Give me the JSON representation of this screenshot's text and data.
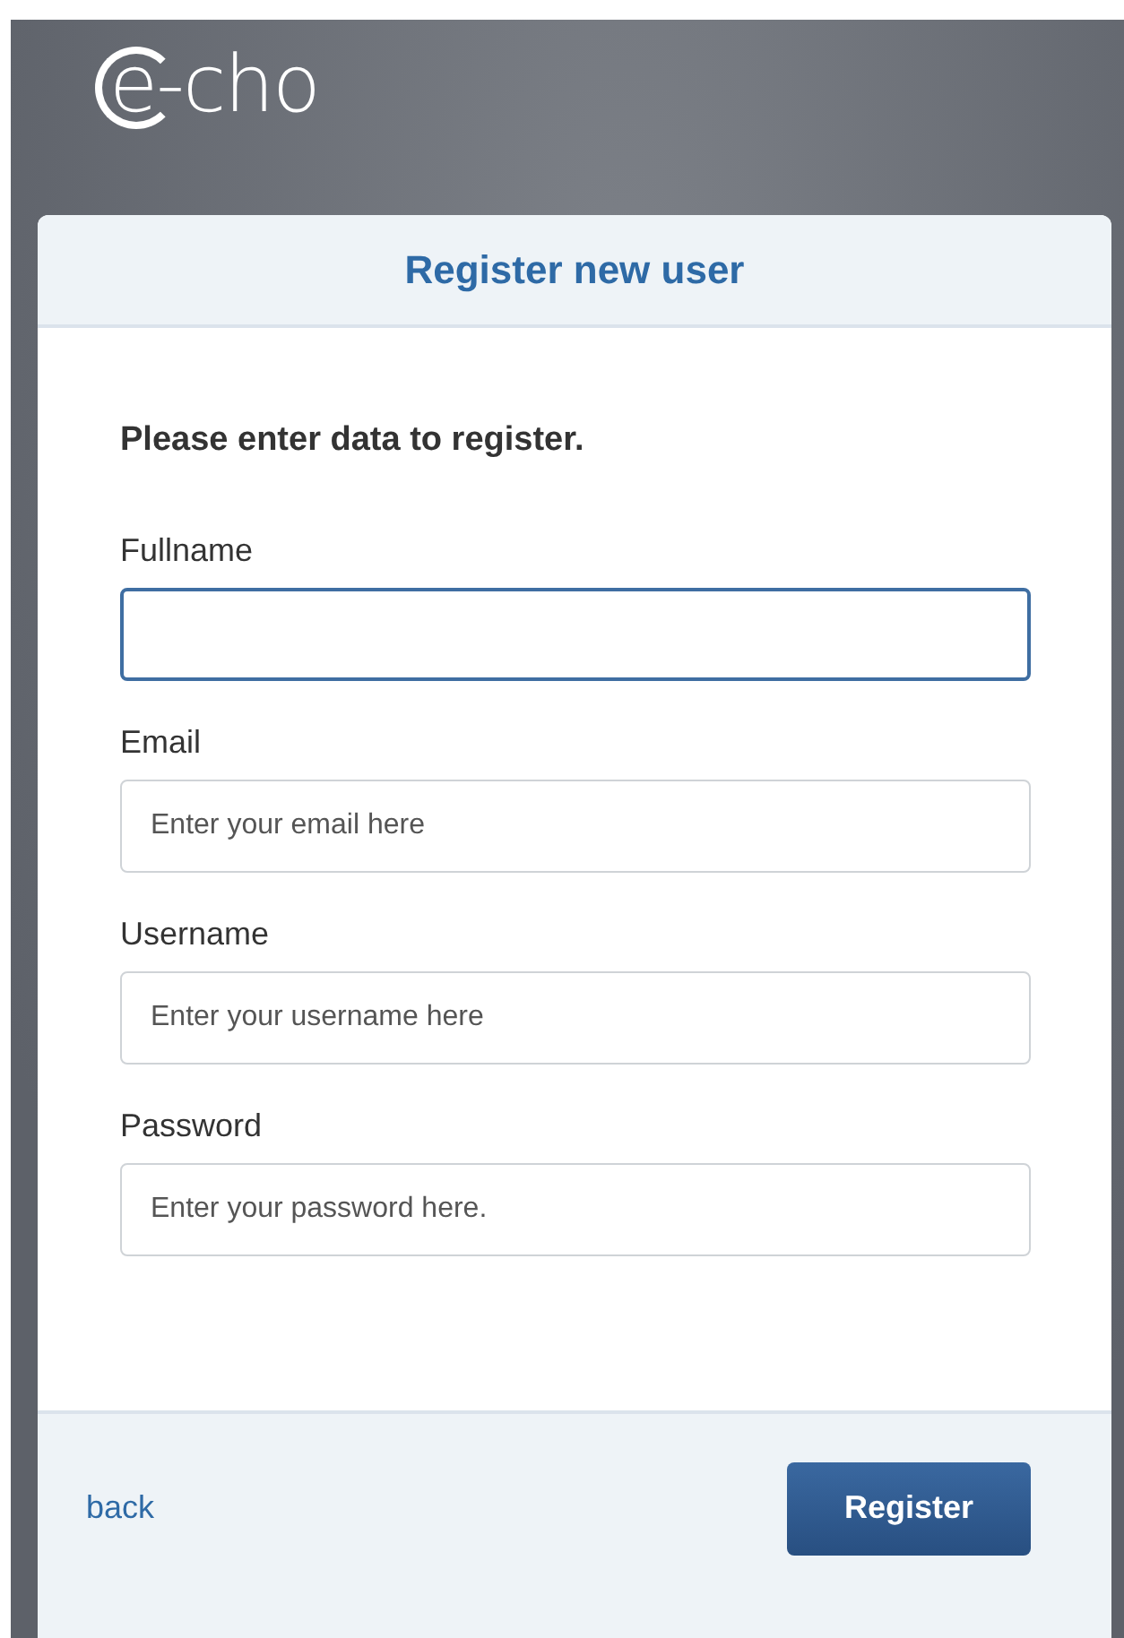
{
  "logo": {
    "text": "e-cho"
  },
  "card": {
    "title": "Register new user",
    "intro": "Please enter data to register.",
    "fields": [
      {
        "label": "Fullname",
        "focused": true
      },
      {
        "label": "Email",
        "placeholder": "Enter your email here",
        "focused": false
      },
      {
        "label": "Username",
        "placeholder": "Enter your username here",
        "focused": false
      },
      {
        "label": "Password",
        "placeholder": "Enter your password here.",
        "focused": false
      }
    ],
    "footer": {
      "link": "back",
      "button": "Register"
    }
  }
}
